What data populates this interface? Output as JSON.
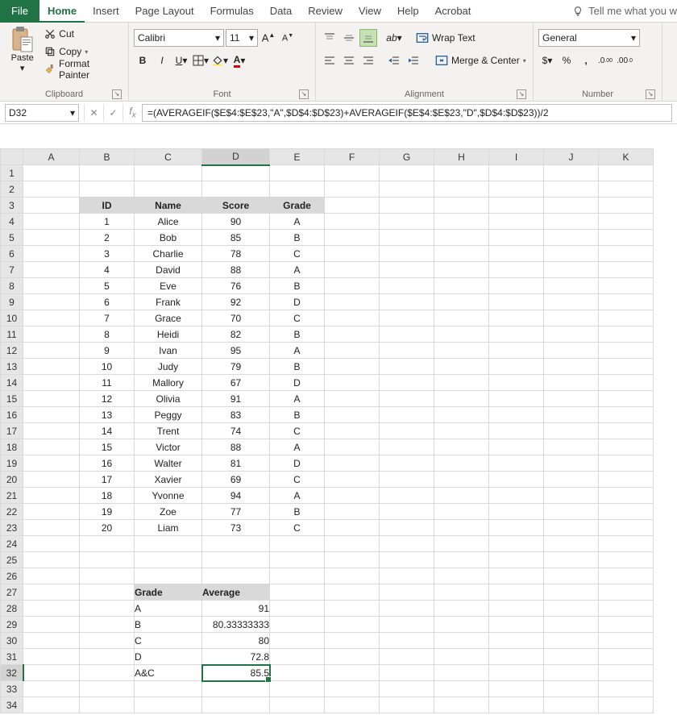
{
  "tabs": {
    "file": "File",
    "items": [
      "Home",
      "Insert",
      "Page Layout",
      "Formulas",
      "Data",
      "Review",
      "View",
      "Help",
      "Acrobat"
    ],
    "active": 0,
    "tellme": "Tell me what you w"
  },
  "ribbon": {
    "clipboard": {
      "label": "Clipboard",
      "paste": "Paste",
      "cut": "Cut",
      "copy": "Copy",
      "format_painter": "Format Painter"
    },
    "font": {
      "label": "Font",
      "name": "Calibri",
      "size": "11"
    },
    "alignment": {
      "label": "Alignment",
      "wrap": "Wrap Text",
      "merge": "Merge & Center"
    },
    "number": {
      "label": "Number",
      "format": "General"
    }
  },
  "formula_bar": {
    "namebox": "D32",
    "formula": "=(AVERAGEIF($E$4:$E$23,\"A\",$D$4:$D$23)+AVERAGEIF($E$4:$E$23,\"D\",$D$4:$D$23))/2"
  },
  "grid": {
    "cols": [
      "A",
      "B",
      "C",
      "D",
      "E",
      "F",
      "G",
      "H",
      "I",
      "J",
      "K"
    ],
    "row_count": 34,
    "selected_cell": {
      "row": 32,
      "col": "D"
    },
    "data_header": {
      "row": 3,
      "cells": {
        "B": "ID",
        "C": "Name",
        "D": "Score",
        "E": "Grade"
      }
    },
    "data_rows": [
      {
        "row": 4,
        "B": "1",
        "C": "Alice",
        "D": "90",
        "E": "A"
      },
      {
        "row": 5,
        "B": "2",
        "C": "Bob",
        "D": "85",
        "E": "B"
      },
      {
        "row": 6,
        "B": "3",
        "C": "Charlie",
        "D": "78",
        "E": "C"
      },
      {
        "row": 7,
        "B": "4",
        "C": "David",
        "D": "88",
        "E": "A"
      },
      {
        "row": 8,
        "B": "5",
        "C": "Eve",
        "D": "76",
        "E": "B"
      },
      {
        "row": 9,
        "B": "6",
        "C": "Frank",
        "D": "92",
        "E": "D"
      },
      {
        "row": 10,
        "B": "7",
        "C": "Grace",
        "D": "70",
        "E": "C"
      },
      {
        "row": 11,
        "B": "8",
        "C": "Heidi",
        "D": "82",
        "E": "B"
      },
      {
        "row": 12,
        "B": "9",
        "C": "Ivan",
        "D": "95",
        "E": "A"
      },
      {
        "row": 13,
        "B": "10",
        "C": "Judy",
        "D": "79",
        "E": "B"
      },
      {
        "row": 14,
        "B": "11",
        "C": "Mallory",
        "D": "67",
        "E": "D"
      },
      {
        "row": 15,
        "B": "12",
        "C": "Olivia",
        "D": "91",
        "E": "A"
      },
      {
        "row": 16,
        "B": "13",
        "C": "Peggy",
        "D": "83",
        "E": "B"
      },
      {
        "row": 17,
        "B": "14",
        "C": "Trent",
        "D": "74",
        "E": "C"
      },
      {
        "row": 18,
        "B": "15",
        "C": "Victor",
        "D": "88",
        "E": "A"
      },
      {
        "row": 19,
        "B": "16",
        "C": "Walter",
        "D": "81",
        "E": "D"
      },
      {
        "row": 20,
        "B": "17",
        "C": "Xavier",
        "D": "69",
        "E": "C"
      },
      {
        "row": 21,
        "B": "18",
        "C": "Yvonne",
        "D": "94",
        "E": "A"
      },
      {
        "row": 22,
        "B": "19",
        "C": "Zoe",
        "D": "77",
        "E": "B"
      },
      {
        "row": 23,
        "B": "20",
        "C": "Liam",
        "D": "73",
        "E": "C"
      }
    ],
    "summary_header": {
      "row": 27,
      "C": "Grade",
      "D": "Average"
    },
    "summary_rows": [
      {
        "row": 28,
        "C": "A",
        "D": "91"
      },
      {
        "row": 29,
        "C": "B",
        "D": "80.33333333"
      },
      {
        "row": 30,
        "C": "C",
        "D": "80"
      },
      {
        "row": 31,
        "C": "D",
        "D": "72.8"
      },
      {
        "row": 32,
        "C": "A&C",
        "D": "85.5"
      }
    ]
  }
}
